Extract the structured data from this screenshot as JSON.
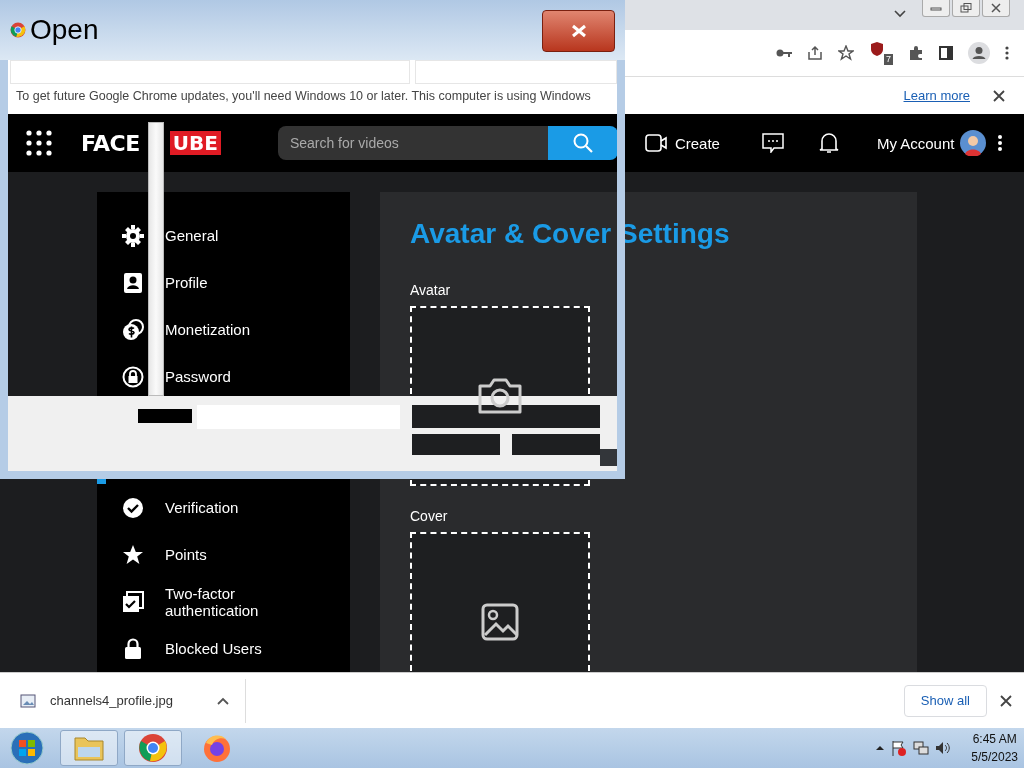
{
  "browser": {
    "extension_badge": "7"
  },
  "infobar": {
    "message": "To get future Google Chrome updates, you'll need Windows 10 or later. This computer is using Windows",
    "link": "Learn more"
  },
  "site": {
    "logo": [
      "FACE",
      "UBE"
    ],
    "search": {
      "placeholder": "Search for videos"
    },
    "create": "Create",
    "account": "My Account"
  },
  "sidebar": {
    "items": [
      {
        "label": "General",
        "kind": "gear"
      },
      {
        "label": "Profile",
        "kind": "profile"
      },
      {
        "label": "Monetization",
        "kind": "coins"
      },
      {
        "label": "Password",
        "kind": "lock"
      },
      {
        "label": "Verification",
        "kind": "check"
      },
      {
        "label": "Points",
        "kind": "star"
      },
      {
        "label": "Two-factor authentication",
        "kind": "tasks"
      },
      {
        "label": "Blocked Users",
        "kind": "padlock"
      }
    ]
  },
  "settings": {
    "title": "Avatar & Cover Settings",
    "sections": [
      {
        "label": "Avatar",
        "kind": "camera"
      },
      {
        "label": "Cover",
        "kind": "image"
      }
    ]
  },
  "dialog": {
    "title": "Open"
  },
  "downloads": {
    "items": [
      {
        "file": "channels4_profile.jpg"
      }
    ],
    "show_all": "Show all"
  },
  "taskbar": {
    "apps": [
      {
        "kind": "explorer",
        "running": true
      },
      {
        "kind": "chrome",
        "running": true
      },
      {
        "kind": "firefox",
        "running": false
      }
    ],
    "time": "6:45 AM",
    "date": "5/5/2023"
  }
}
